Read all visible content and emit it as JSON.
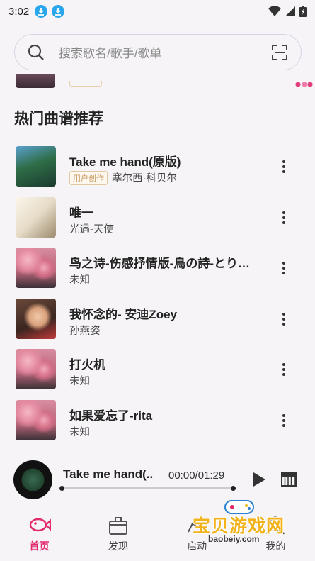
{
  "status_bar": {
    "time": "3:02"
  },
  "search": {
    "placeholder": "搜索歌名/歌手/歌单"
  },
  "section": {
    "title": "热门曲谱推荐"
  },
  "songs": [
    {
      "title": "Take me hand(原版)",
      "badge": "用户创作",
      "artist": "塞尔西·科贝尔"
    },
    {
      "title": "唯一",
      "badge": "",
      "artist": "光遇-天使"
    },
    {
      "title": "鸟之诗-伤感抒情版-鳥の詩-とり…",
      "badge": "",
      "artist": "未知"
    },
    {
      "title": "我怀念的- 安迪Zoey",
      "badge": "",
      "artist": "孙燕姿"
    },
    {
      "title": "打火机",
      "badge": "",
      "artist": "未知"
    },
    {
      "title": "如果爱忘了-rita",
      "badge": "",
      "artist": "未知"
    }
  ],
  "player": {
    "title": "Take me hand(..",
    "time": "00:00/01:29",
    "progress": 0
  },
  "nav": {
    "items": [
      {
        "label": "首页",
        "active": true
      },
      {
        "label": "发现",
        "active": false
      },
      {
        "label": "启动",
        "active": false
      },
      {
        "label": "我的",
        "active": false
      }
    ]
  },
  "watermark": {
    "text": "宝贝游戏网",
    "sub": "baobeiy.com"
  },
  "colors": {
    "accent": "#e2296e",
    "badge": "#c79a62",
    "download": "#29a6ec"
  }
}
